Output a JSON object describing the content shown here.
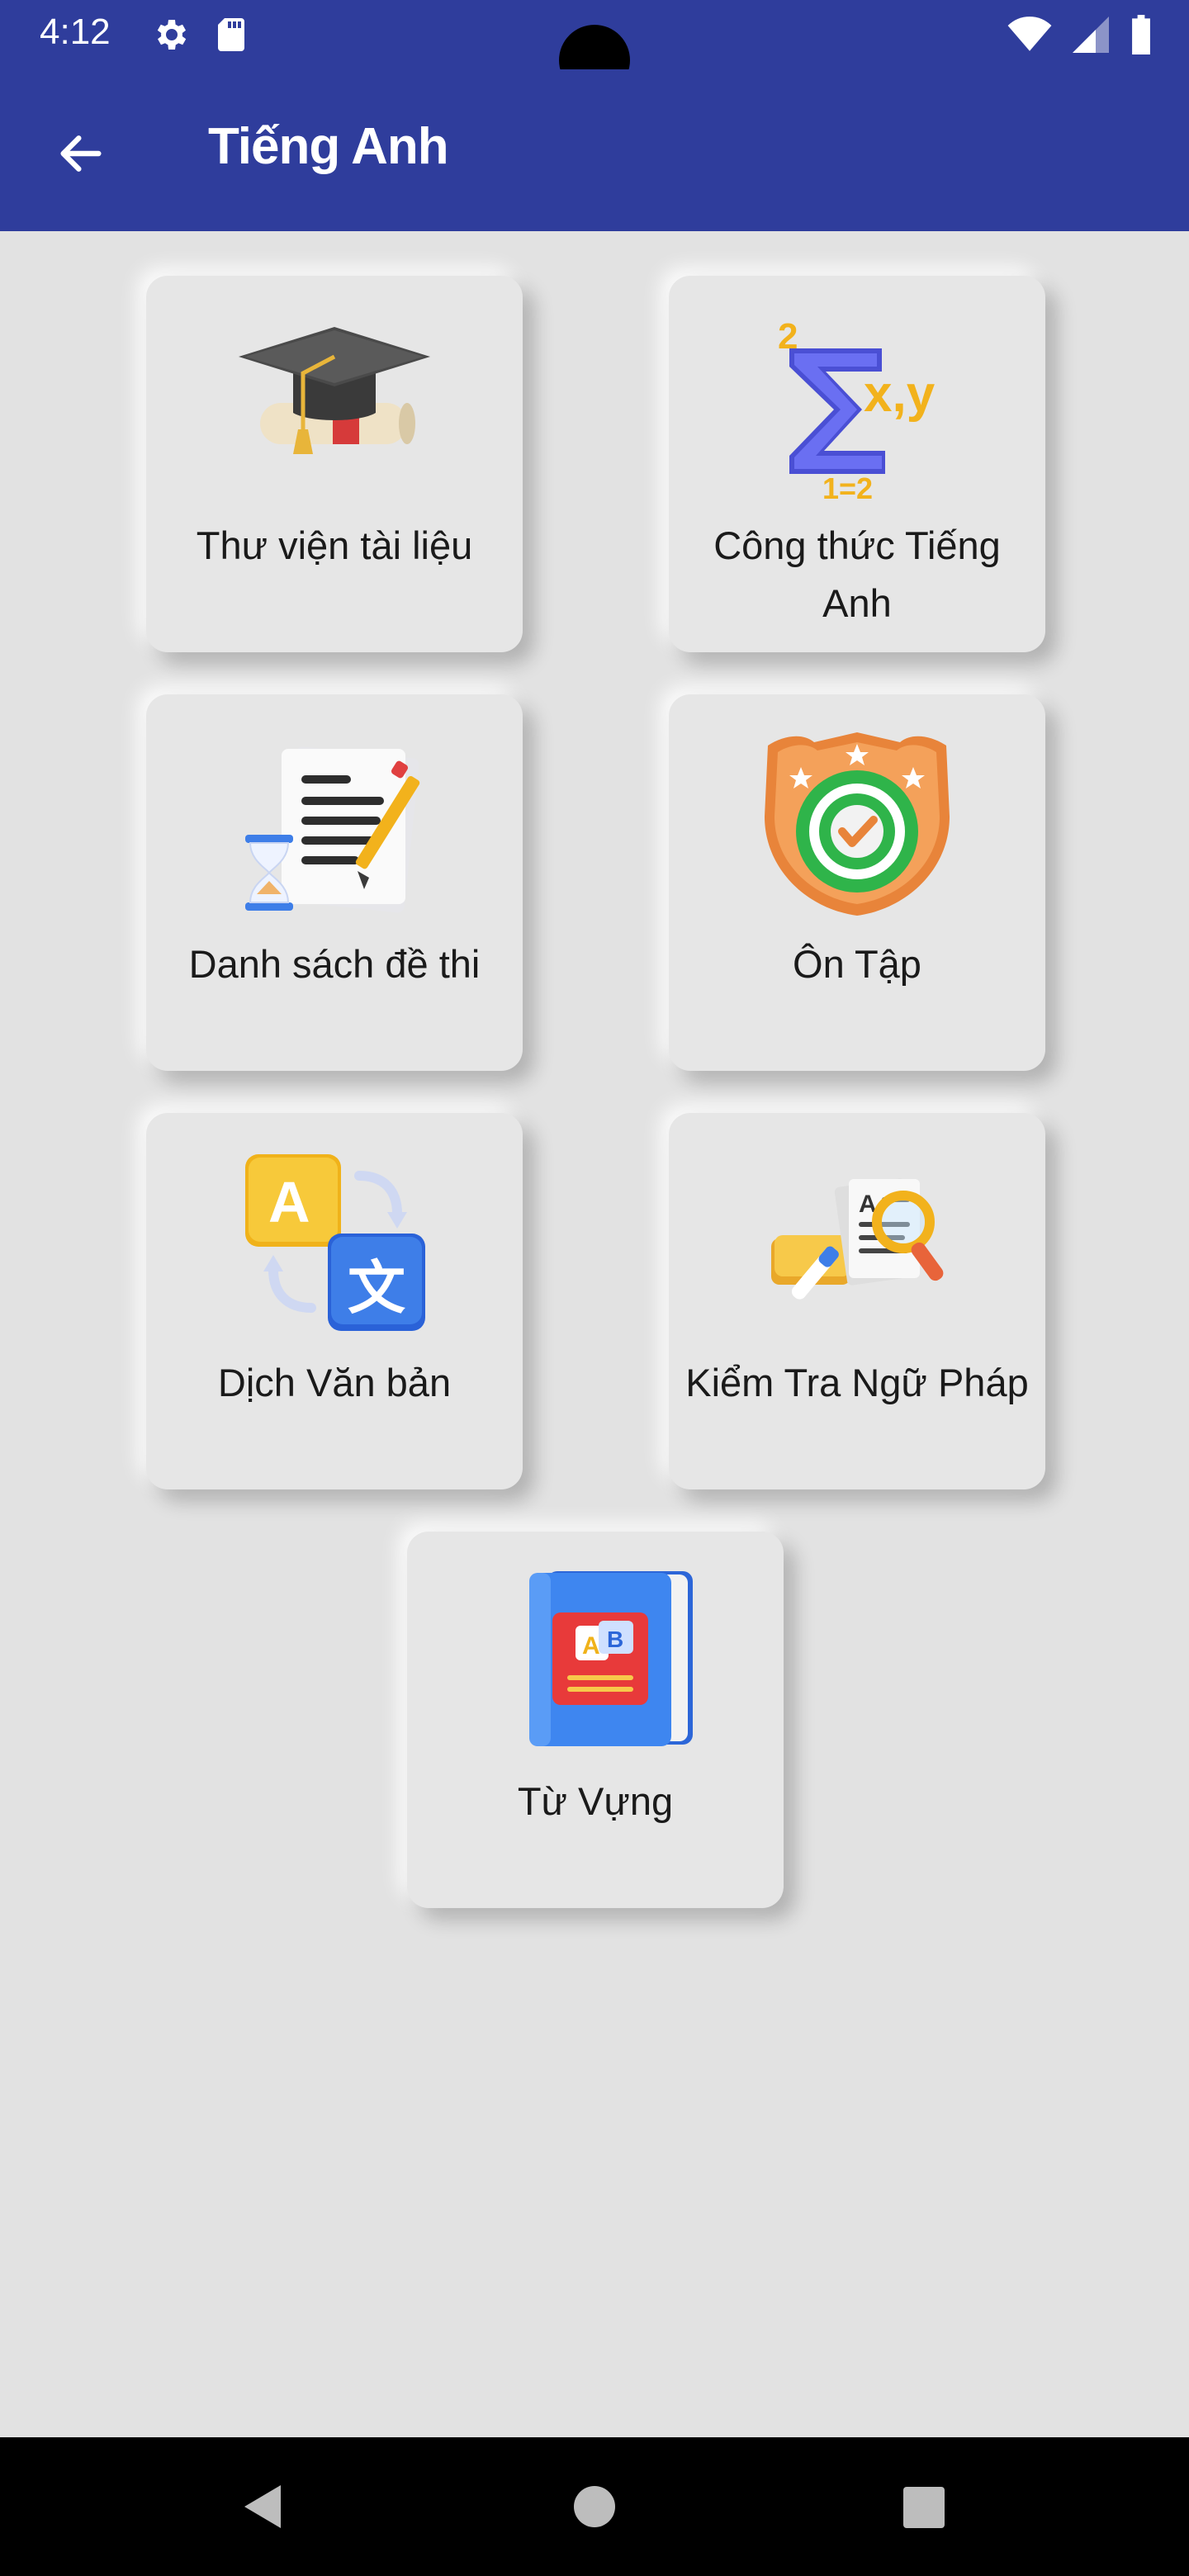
{
  "status": {
    "time": "4:12",
    "icons": [
      "gear-icon",
      "sd-card-icon",
      "wifi-icon",
      "signal-icon",
      "battery-icon"
    ]
  },
  "app_bar": {
    "title": "Tiếng Anh",
    "back_icon": "arrow-left-icon",
    "background": "#2f3d9c"
  },
  "menu": {
    "items": [
      {
        "label": "Thư viện tài liệu",
        "icon": "graduation-cap-icon"
      },
      {
        "label": "Công thức Tiếng Anh",
        "icon": "sigma-formula-icon"
      },
      {
        "label": "Danh sách đề thi",
        "icon": "exam-paper-icon"
      },
      {
        "label": "Ôn Tập",
        "icon": "badge-check-icon"
      },
      {
        "label": "Dịch Văn bản",
        "icon": "translate-icon"
      },
      {
        "label": "Kiểm Tra Ngữ Pháp",
        "icon": "grammar-check-icon"
      },
      {
        "label": "Từ Vựng",
        "icon": "vocabulary-book-icon"
      }
    ]
  },
  "nav_bar": {
    "buttons": [
      "back-triangle-icon",
      "home-circle-icon",
      "recents-square-icon"
    ]
  }
}
